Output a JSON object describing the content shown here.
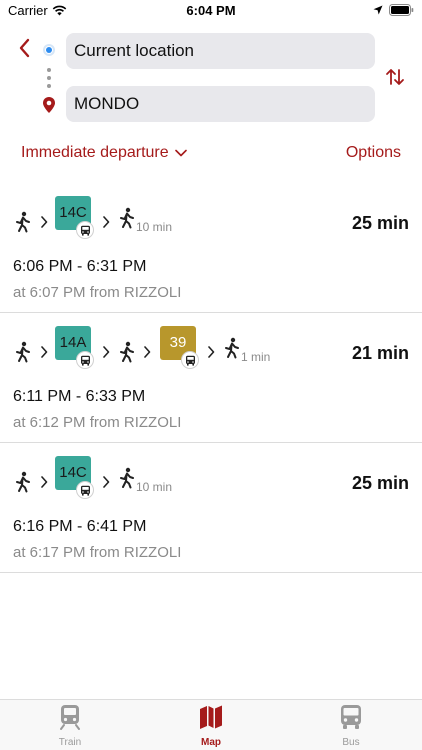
{
  "status_bar": {
    "carrier": "Carrier",
    "time": "6:04 PM"
  },
  "route": {
    "origin": "Current location",
    "destination": "MONDO"
  },
  "departure": {
    "mode_label": "Immediate departure",
    "options_label": "Options"
  },
  "results": [
    {
      "legs": [
        {
          "type": "walk"
        },
        {
          "type": "bus",
          "line": "14C",
          "color": "#3aa89a"
        },
        {
          "type": "walk",
          "minutes": "10 min"
        }
      ],
      "duration": "25 min",
      "time_range": "6:06 PM - 6:31 PM",
      "departure_info": "at 6:07 PM from RIZZOLI"
    },
    {
      "legs": [
        {
          "type": "walk"
        },
        {
          "type": "bus",
          "line": "14A",
          "color": "#3aa89a"
        },
        {
          "type": "walk"
        },
        {
          "type": "bus",
          "line": "39",
          "color": "#b8972c"
        },
        {
          "type": "walk",
          "minutes": "1 min"
        }
      ],
      "duration": "21 min",
      "time_range": "6:11 PM - 6:33 PM",
      "departure_info": "at 6:12 PM from RIZZOLI"
    },
    {
      "legs": [
        {
          "type": "walk"
        },
        {
          "type": "bus",
          "line": "14C",
          "color": "#3aa89a"
        },
        {
          "type": "walk",
          "minutes": "10 min"
        }
      ],
      "duration": "25 min",
      "time_range": "6:16 PM - 6:41 PM",
      "departure_info": "at 6:17 PM from RIZZOLI"
    }
  ],
  "tabs": [
    {
      "label": "Train",
      "icon": "train-icon",
      "active": false
    },
    {
      "label": "Map",
      "icon": "map-icon",
      "active": true
    },
    {
      "label": "Bus",
      "icon": "bus-icon",
      "active": false
    }
  ],
  "colors": {
    "accent": "#a51b1b",
    "origin_dot": "#2d8cf0",
    "line_14": "#3aa89a",
    "line_39": "#b8972c",
    "field_bg": "#e8e8ec"
  }
}
